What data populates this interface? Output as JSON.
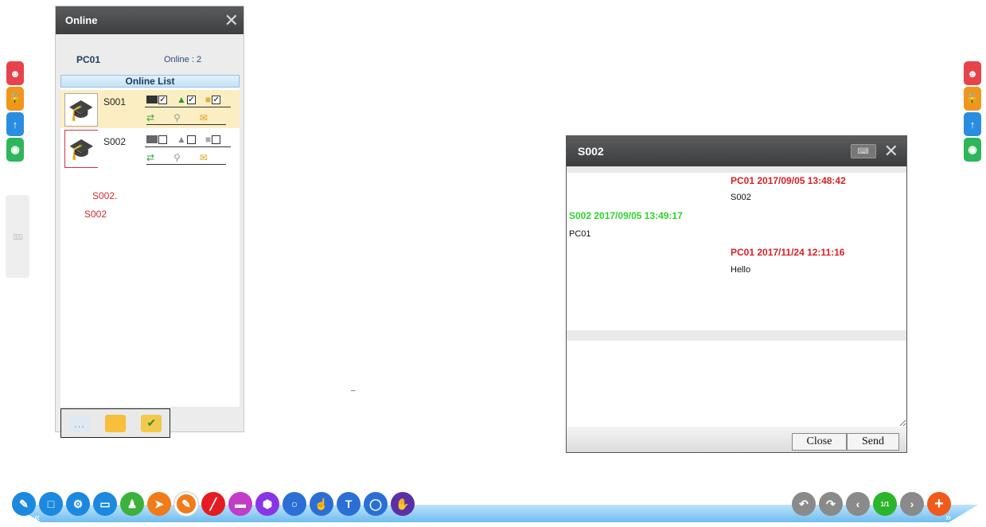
{
  "online_panel": {
    "title": "Online",
    "pc_name": "PC01",
    "online_count": "Online : 2",
    "list_header": "Online List",
    "students": [
      {
        "name": "S001",
        "selected": true
      },
      {
        "name": "S002",
        "selected": false
      }
    ],
    "notes": [
      "S002.",
      "S002"
    ]
  },
  "dash": "_",
  "chat": {
    "title": "S002",
    "messages": [
      {
        "header": "PC01 2017/09/05 13:48:42",
        "body": "S002",
        "side": "right",
        "color": "#d81f26"
      },
      {
        "header": "S002 2017/09/05 13:49:17",
        "body": "PC01",
        "side": "left",
        "color": "#2dd42d"
      },
      {
        "header": "PC01 2017/11/24 12:11:16",
        "body": "Hello",
        "side": "right",
        "color": "#d81f26"
      }
    ],
    "close_label": "Close",
    "send_label": "Send"
  },
  "toolbar": {
    "page_indicator": "1/1"
  },
  "colors": {
    "accent_blue": "#1c88df",
    "toolbar_bar": "#6dbdf0",
    "header_dark": "#3c3e40"
  }
}
